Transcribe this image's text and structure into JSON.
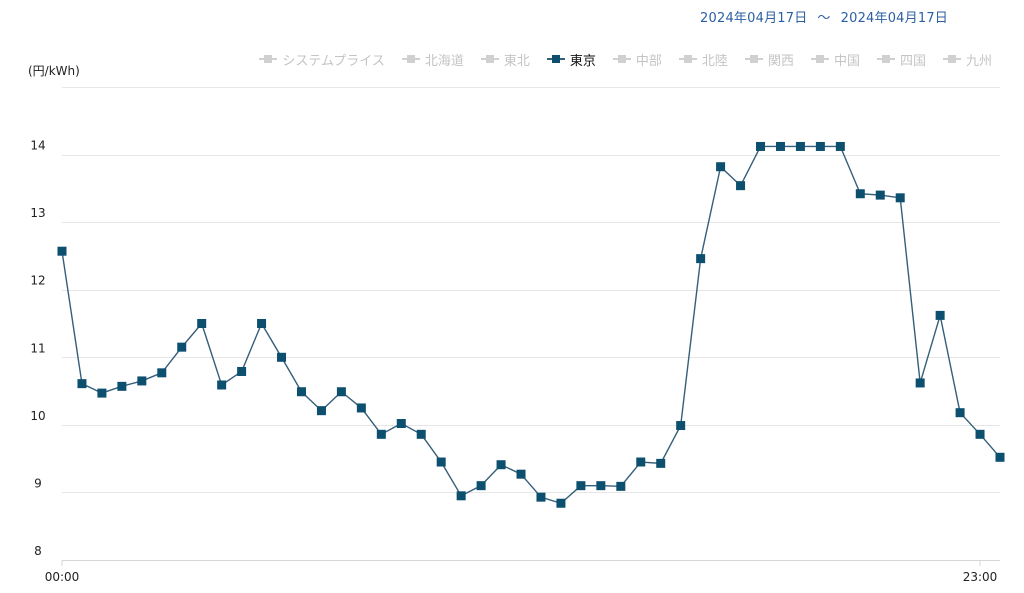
{
  "date_range": {
    "start": "2024年04月17日",
    "separator": "〜",
    "end": "2024年04月17日"
  },
  "legend": {
    "items": [
      {
        "label": "システムプライス",
        "active": false
      },
      {
        "label": "北海道",
        "active": false
      },
      {
        "label": "東北",
        "active": false
      },
      {
        "label": "東京",
        "active": true
      },
      {
        "label": "中部",
        "active": false
      },
      {
        "label": "北陸",
        "active": false
      },
      {
        "label": "関西",
        "active": false
      },
      {
        "label": "中国",
        "active": false
      },
      {
        "label": "四国",
        "active": false
      },
      {
        "label": "九州",
        "active": false
      }
    ]
  },
  "colors": {
    "series_line": "#355e7a",
    "series_marker": "#0d4f6e",
    "grid": "#e6e6e6",
    "axis": "#d6d6d6",
    "tick_label": "#222222",
    "date_text": "#2b5fa3"
  },
  "chart_data": {
    "type": "line",
    "ylabel": "(円/kWh)",
    "ylim": [
      8,
      15
    ],
    "yticks": [
      8,
      9,
      10,
      11,
      12,
      13,
      14
    ],
    "grid": true,
    "legend_position": "top-right",
    "x_tick_labels": [
      {
        "index": 0,
        "label": "00:00"
      },
      {
        "index": 46,
        "label": "23:00"
      }
    ],
    "series": [
      {
        "name": "東京",
        "values": [
          12.57,
          10.61,
          10.47,
          10.57,
          10.65,
          10.77,
          11.15,
          11.5,
          10.59,
          10.79,
          11.5,
          11.0,
          10.49,
          10.21,
          10.49,
          10.25,
          9.86,
          10.02,
          9.86,
          9.45,
          8.95,
          9.1,
          9.41,
          9.27,
          8.93,
          8.84,
          9.1,
          9.1,
          9.09,
          9.45,
          9.43,
          9.99,
          12.46,
          13.82,
          13.54,
          14.12,
          14.12,
          14.12,
          14.12,
          14.12,
          13.42,
          13.4,
          13.36,
          10.62,
          11.62,
          10.18,
          9.86,
          9.52
        ]
      }
    ]
  }
}
